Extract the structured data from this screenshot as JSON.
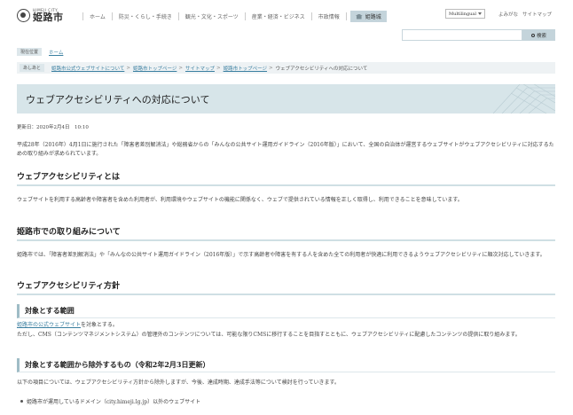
{
  "header": {
    "logo_sub": "HIMEJI CITY",
    "logo_name": "姫路市",
    "nav": [
      "ホーム",
      "防災・くらし・手続き",
      "観光・文化・スポーツ",
      "産業・経済・ビジネス",
      "市政情報",
      "姫路城"
    ],
    "multilingual": "Multilingual",
    "links": [
      "よみがな",
      "サイトマップ"
    ],
    "search_button": "検索"
  },
  "location": {
    "label": "現在位置",
    "home": "ホーム"
  },
  "breadcrumb": {
    "label": "あしあと",
    "items": [
      "姫路市公式ウェブサイトについて",
      "姫路市トップページ",
      "サイトマップ",
      "姫路市トップページ"
    ],
    "current": "ウェブアクセシビリティへの対応について"
  },
  "page": {
    "title": "ウェブアクセシビリティへの対応について",
    "date": "更新日：2020年2月4日　10:10",
    "intro": "平成28年（2016年）4月1日に施行された「障害者差別解消法」や総務省からの「みんなの公共サイト運用ガイドライン（2016年版）」において、全国の自治体が運営するウェブサイトがウェブアクセシビリティに対応するための取り組みが求められています。",
    "h2_1": "ウェブアクセシビリティとは",
    "p1": "ウェブサイトを利用する高齢者や障害者を含めた利用者が、利用環境やウェブサイトの機能に関係なく、ウェブで提供されている情報を正しく取得し、利用できることを意味しています。",
    "h2_2": "姫路市での取り組みについて",
    "p2": "姫路市では、「障害者差別解消法」や「みんなの公共サイト運用ガイドライン（2016年版）」で示す高齢者や障害を有する人を含めた全ての利用者が快適に利用できるようウェブアクセシビリティに順次対応していきます。",
    "h2_3": "ウェブアクセシビリティ方針",
    "h3_1": "対象とする範囲",
    "scope_link": "姫路市の公式ウェブサイト",
    "scope_suffix": "を対象とする。",
    "scope_note": "ただし、CMS（コンテンツマネジメントシステム）の管理外のコンテンツについては、可能な限りCMSに移行することを目指すとともに、ウェブアクセシビリティに配慮したコンテンツの提供に取り組みます。",
    "h3_2": "対象とする範囲から除外するもの（令和2年2月3日更新）",
    "p3": "以下の項目については、ウェブアクセシビリティ方針から除外しますが、今後、達成時期、達成手法等について検討を行っていきます。",
    "bullet1": "姫路市が運用しているドメイン（city.himeji.lg.jp）以外のウェブサイト"
  },
  "colors": {
    "accent": "#d7e5e9",
    "link": "#3a7fa0"
  }
}
